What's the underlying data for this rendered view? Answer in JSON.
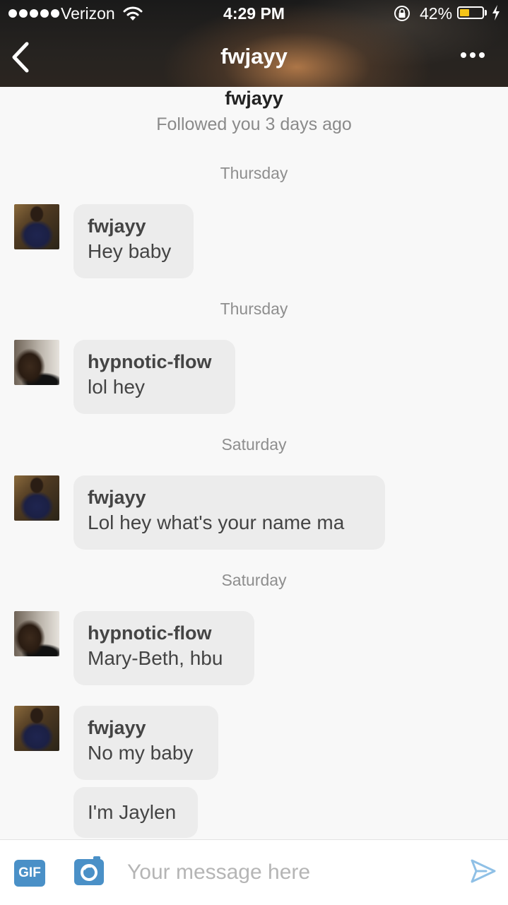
{
  "status_bar": {
    "carrier": "Verizon",
    "time": "4:29 PM",
    "battery_percent": "42%",
    "battery_level": 0.42,
    "signal_bars": 5
  },
  "nav": {
    "title": "fwjayy",
    "back_icon": "chevron-left-icon",
    "more_icon": "ellipsis-icon"
  },
  "profile": {
    "name": "fwjayy",
    "subtitle": "Followed you 3 days ago"
  },
  "messages": [
    {
      "day": "Thursday",
      "sender": "fwjayy",
      "text": "Hey baby"
    },
    {
      "day": "Thursday",
      "sender": "hypnotic-flow",
      "text": "lol hey"
    },
    {
      "day": "Saturday",
      "sender": "fwjayy",
      "text": "Lol hey what's your name ma"
    },
    {
      "day": "Saturday",
      "sender": "hypnotic-flow",
      "text": "Mary-Beth, hbu"
    },
    {
      "sender": "fwjayy",
      "text": "No my baby"
    },
    {
      "text": "I'm Jaylen"
    }
  ],
  "composer": {
    "gif_label": "GIF",
    "placeholder": "Your message here",
    "value": ""
  },
  "colors": {
    "accent": "#4a90c7",
    "bubble": "#ececec",
    "battery": "#f5c518"
  }
}
